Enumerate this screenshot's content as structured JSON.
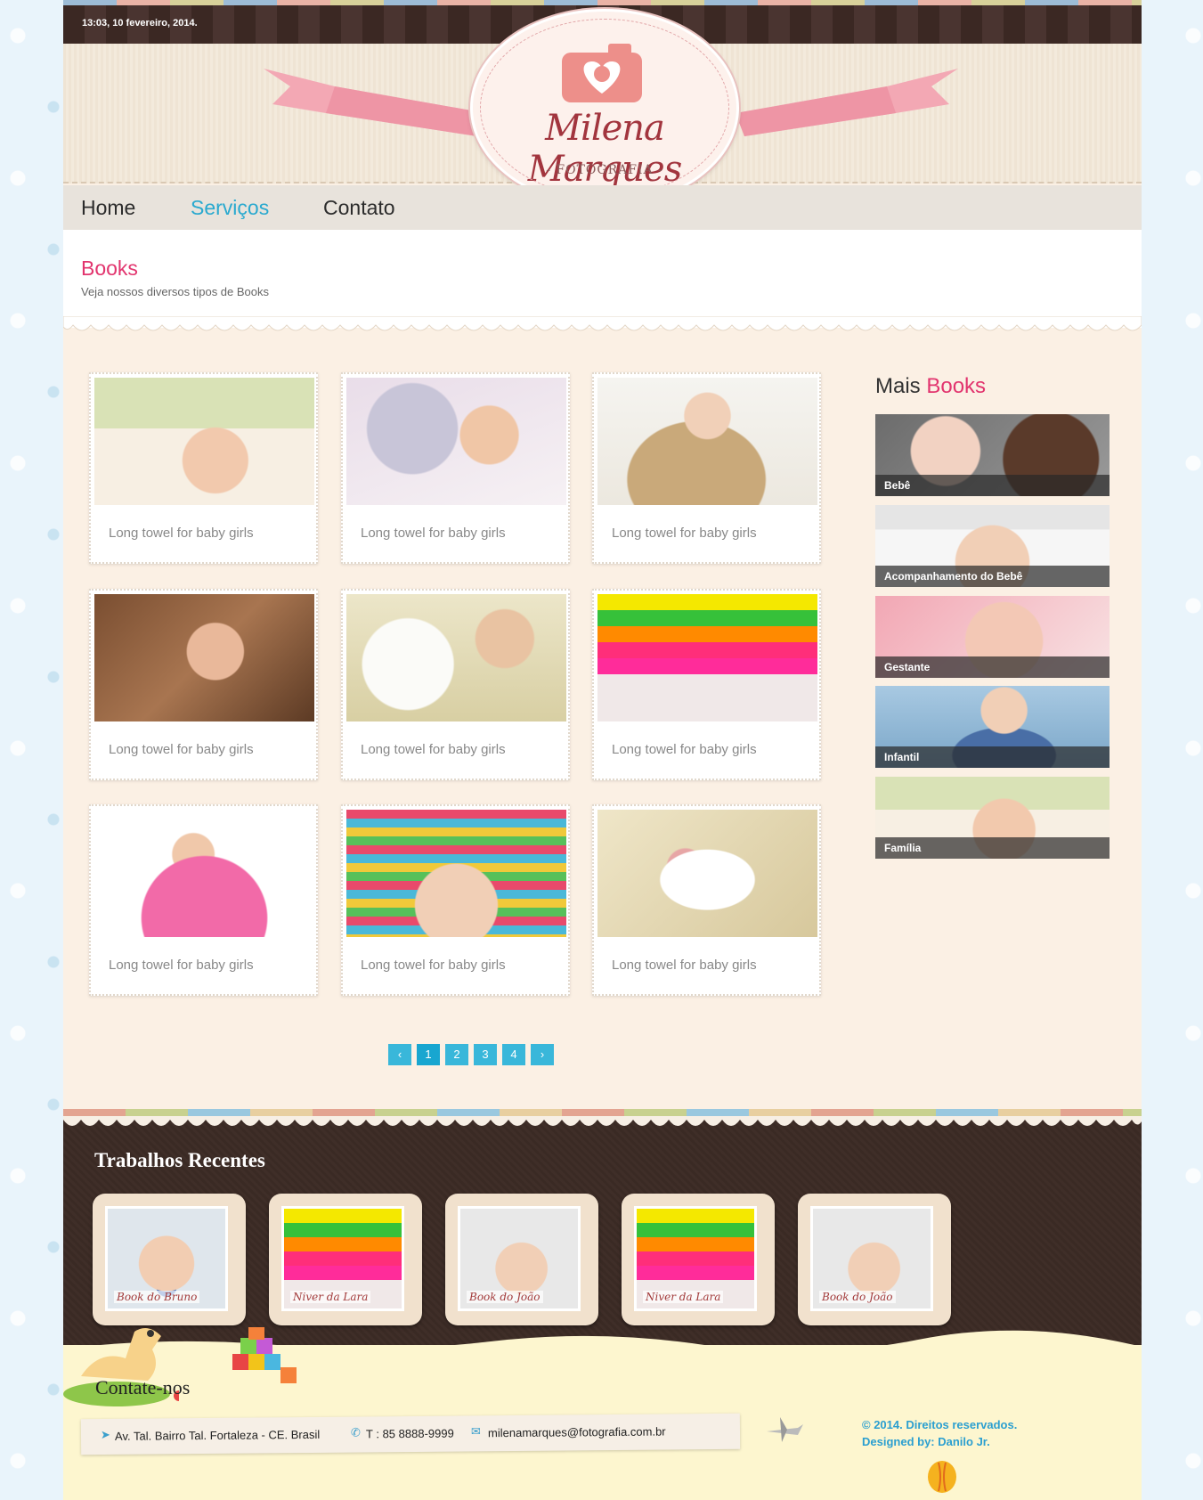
{
  "topbar": {
    "date": "13:03, 10 fevereiro, 2014."
  },
  "logo": {
    "name": "Milena Marques",
    "subtitle": "- FOTOGRAFIA -"
  },
  "nav": [
    {
      "label": "Home",
      "active": false
    },
    {
      "label": "Serviços",
      "active": true
    },
    {
      "label": "Contato",
      "active": false
    }
  ],
  "page": {
    "title": "Books",
    "subtitle": "Veja nossos diversos tipos de Books"
  },
  "gallery": {
    "items": [
      {
        "caption": "Long towel for baby girls",
        "photo": "baby-under-blanket"
      },
      {
        "caption": "Long towel for baby girls",
        "photo": "girl-with-plush"
      },
      {
        "caption": "Long towel for baby girls",
        "photo": "baby-in-basket"
      },
      {
        "caption": "Long towel for baby girls",
        "photo": "child-with-teddy-bears"
      },
      {
        "caption": "Long towel for baby girls",
        "photo": "baby-with-white-bear"
      },
      {
        "caption": "Long towel for baby girls",
        "photo": "stacking-rings"
      },
      {
        "caption": "Long towel for baby girls",
        "photo": "girl-on-pink-umbrella"
      },
      {
        "caption": "Long towel for baby girls",
        "photo": "baby-knit-hat"
      },
      {
        "caption": "Long towel for baby girls",
        "photo": "newborn-in-hammock"
      }
    ]
  },
  "pagination": {
    "prev": "‹",
    "pages": [
      "1",
      "2",
      "3",
      "4"
    ],
    "current": "1",
    "next": "›"
  },
  "sidebar": {
    "title_plain": "Mais",
    "title_accent": "Books",
    "items": [
      {
        "label": "Bebê"
      },
      {
        "label": "Acompanhamento do Bebê"
      },
      {
        "label": "Gestante"
      },
      {
        "label": "Infantil"
      },
      {
        "label": "Família"
      }
    ]
  },
  "recent": {
    "title": "Trabalhos Recentes",
    "items": [
      {
        "caption": "Book do Bruno"
      },
      {
        "caption": "Niver da Lara"
      },
      {
        "caption": "Book do João"
      },
      {
        "caption": "Niver da Lara"
      },
      {
        "caption": "Book do João"
      }
    ]
  },
  "contact": {
    "title": "Contate-nos",
    "address": "Av. Tal. Bairro Tal. Fortaleza - CE. Brasil",
    "phone": "T : 85 8888-9999",
    "email": "milenamarques@fotografia.com.br"
  },
  "footer": {
    "copyright": "© 2014. Direitos reservados.",
    "designed_by": "Designed by: Danilo Jr."
  },
  "colors": {
    "accent_pink": "#e2346e",
    "accent_blue": "#29a9cf",
    "brown": "#3b2823"
  }
}
